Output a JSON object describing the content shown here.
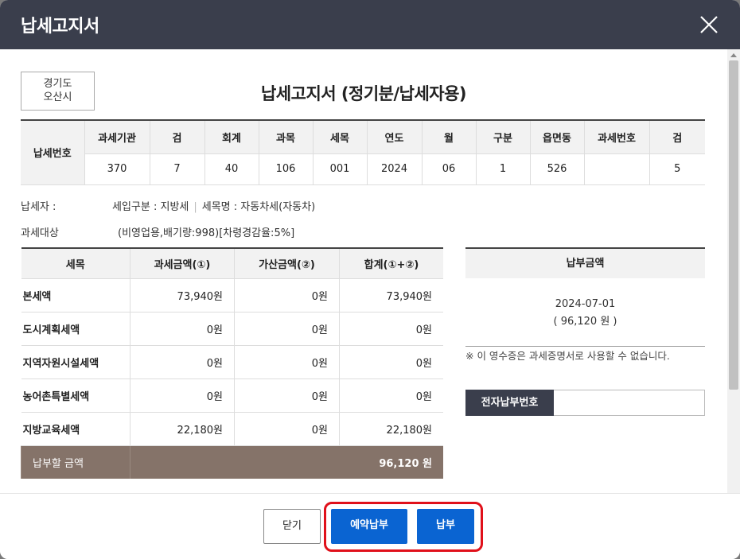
{
  "window": {
    "title": "납세고지서"
  },
  "org": {
    "line1": "경기도",
    "line2": "오산시"
  },
  "doc_title": "납세고지서 (정기분/납세자용)",
  "tax_number": {
    "row_label": "납세번호",
    "headers": [
      "과세기관",
      "검",
      "회계",
      "과목",
      "세목",
      "연도",
      "월",
      "구분",
      "읍면동",
      "과세번호",
      "검"
    ],
    "values": [
      "370",
      "7",
      "40",
      "106",
      "001",
      "2024",
      "06",
      "1",
      "526",
      "",
      "5"
    ]
  },
  "taxpayer": {
    "label": "납세자 :",
    "income_type": "세입구분 : 지방세",
    "item_name": "세목명 : 자동차세(자동차)"
  },
  "target": {
    "label": "과세대상",
    "value": "(비영업용,배기량:998)[차령경감율:5%]"
  },
  "amounts": {
    "headers": [
      "세목",
      "과세금액(①)",
      "가산금액(②)",
      "합계(①+②)"
    ],
    "rows": [
      {
        "name": "본세액",
        "base": "73,940원",
        "extra": "0원",
        "sum": "73,940원"
      },
      {
        "name": "도시계획세액",
        "base": "0원",
        "extra": "0원",
        "sum": "0원"
      },
      {
        "name": "지역자원시설세액",
        "base": "0원",
        "extra": "0원",
        "sum": "0원"
      },
      {
        "name": "농어촌특별세액",
        "base": "0원",
        "extra": "0원",
        "sum": "0원"
      },
      {
        "name": "지방교육세액",
        "base": "22,180원",
        "extra": "0원",
        "sum": "22,180원"
      }
    ],
    "total_label": "납부할 금액",
    "total_value": "96,120 원"
  },
  "due": {
    "header": "납부금액",
    "date": "2024-07-01",
    "amount": "( 96,120 원 )"
  },
  "notice": "※ 이 영수증은 과세증명서로 사용할 수 없습니다.",
  "epay": {
    "label": "전자납부번호",
    "value": ""
  },
  "buttons": {
    "close": "닫기",
    "reserve": "예약납부",
    "pay": "납부"
  },
  "colors": {
    "header_bg": "#3a3e4c",
    "primary": "#0a64d2",
    "total_bg": "#857369",
    "highlight": "#e0101a"
  }
}
